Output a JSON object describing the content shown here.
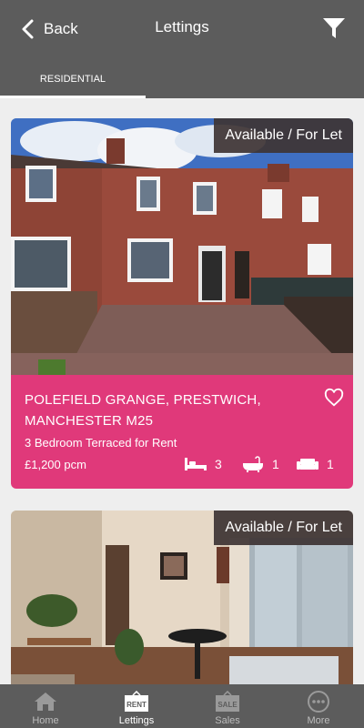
{
  "header": {
    "back_label": "Back",
    "title": "Lettings"
  },
  "tabs": [
    {
      "label": "RESIDENTIAL",
      "active": true
    }
  ],
  "listings": [
    {
      "badge": "Available / For Let",
      "address": "POLEFIELD GRANGE, PRESTWICH, MANCHESTER M25",
      "description": "3 Bedroom Terraced for Rent",
      "price": "£1,200 pcm",
      "bedrooms": "3",
      "bathrooms": "1",
      "receptions": "1"
    },
    {
      "badge": "Available / For Let"
    }
  ],
  "bottom_nav": [
    {
      "label": "Home",
      "icon": "home-icon"
    },
    {
      "label": "Lettings",
      "icon": "rent-sign-icon",
      "icon_text": "RENT",
      "active": true
    },
    {
      "label": "Sales",
      "icon": "sale-sign-icon",
      "icon_text": "SALE"
    },
    {
      "label": "More",
      "icon": "more-icon"
    }
  ],
  "colors": {
    "header": "#5c5c5c",
    "accent": "#e0397a",
    "badge": "#3e3434"
  }
}
